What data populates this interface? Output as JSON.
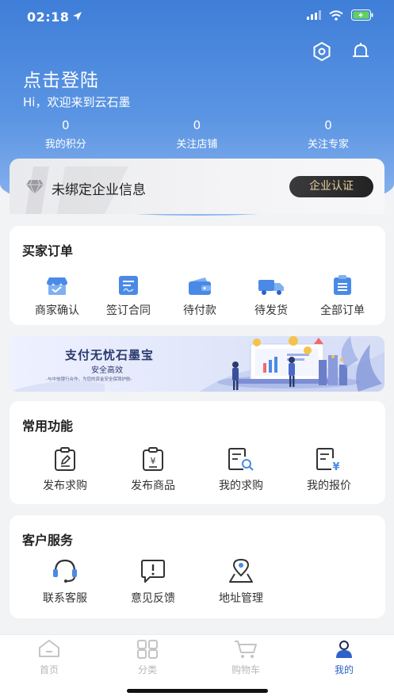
{
  "status_bar": {
    "time": "02:18"
  },
  "header": {
    "login_title": "点击登陆",
    "welcome": "Hi，欢迎来到云石墨",
    "stats": [
      {
        "value": "0",
        "label": "我的积分"
      },
      {
        "value": "0",
        "label": "关注店铺"
      },
      {
        "value": "0",
        "label": "关注专家"
      }
    ]
  },
  "company": {
    "text": "未绑定企业信息",
    "button": "企业认证"
  },
  "buyer_orders": {
    "title": "买家订单",
    "items": [
      {
        "label": "商家确认",
        "icon": "merchant-confirm-icon"
      },
      {
        "label": "签订合同",
        "icon": "contract-icon"
      },
      {
        "label": "待付款",
        "icon": "wallet-icon"
      },
      {
        "label": "待发货",
        "icon": "truck-icon"
      },
      {
        "label": "全部订单",
        "icon": "order-list-icon"
      }
    ]
  },
  "banner": {
    "title": "支付无忧石墨宝",
    "subtitle": "安全高效",
    "tagline": "-与中信银行合作，为您的资金安全保驾护航-"
  },
  "common_functions": {
    "title": "常用功能",
    "items": [
      {
        "label": "发布求购",
        "icon": "publish-request-icon"
      },
      {
        "label": "发布商品",
        "icon": "publish-product-icon"
      },
      {
        "label": "我的求购",
        "icon": "my-requests-icon"
      },
      {
        "label": "我的报价",
        "icon": "my-quotes-icon"
      }
    ]
  },
  "customer_service": {
    "title": "客户服务",
    "items": [
      {
        "label": "联系客服",
        "icon": "headset-icon"
      },
      {
        "label": "意见反馈",
        "icon": "feedback-icon"
      },
      {
        "label": "地址管理",
        "icon": "location-icon"
      }
    ]
  },
  "tabbar": {
    "tabs": [
      {
        "label": "首页",
        "icon": "home-icon"
      },
      {
        "label": "分类",
        "icon": "category-icon"
      },
      {
        "label": "购物车",
        "icon": "cart-icon"
      },
      {
        "label": "我的",
        "icon": "profile-icon",
        "active": true
      }
    ]
  },
  "colors": {
    "primary": "#3f7ed8",
    "accent_gold": "#e9cf9b",
    "icon_blue": "#4a8ae6",
    "active_tab": "#2d62c8"
  }
}
